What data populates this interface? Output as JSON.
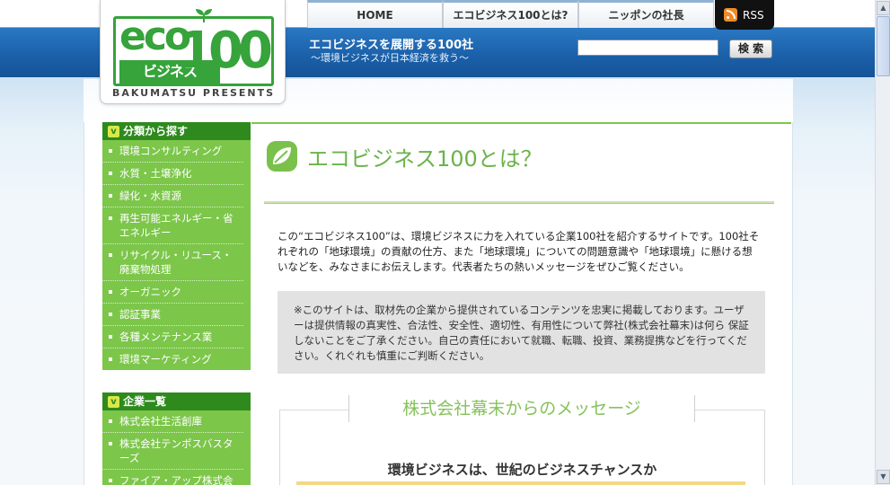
{
  "logo": {
    "eco": "eco",
    "biz": "ビジネス",
    "num": "100",
    "presents": "BAKUMATSU PRESENTS"
  },
  "nav": {
    "tabs": [
      "HOME",
      "エコビジネス100とは?",
      "ニッポンの社長"
    ],
    "rss": "RSS"
  },
  "header": {
    "tagline_main": "エコビジネスを展開する100社",
    "tagline_sub": "〜環境ビジネスが日本経済を救う〜"
  },
  "search": {
    "value": "",
    "placeholder": "",
    "button": "検 索"
  },
  "sidebar": {
    "category_heading": "分類から探す",
    "categories": [
      "環境コンサルティング",
      "水質・土壌浄化",
      "緑化・水資源",
      "再生可能エネルギー・省エネルギー",
      "リサイクル・リユース・廃棄物処理",
      "オーガニック",
      "認証事業",
      "各種メンテナンス業",
      "環境マーケティング"
    ],
    "company_heading": "企業一覧",
    "companies": [
      "株式会社生活創庫",
      "株式会社テンポスバスターズ",
      "ファイア・アップ株式会社"
    ]
  },
  "main": {
    "title": "エコビジネス100とは？",
    "intro": "この“エコビジネス100”は、環境ビジネスに力を入れている企業100社を紹介するサイトです。100社それぞれの「地球環境」の貢献の仕方、また「地球環境」についての問題意識や「地球環境」に懸ける想 いなどを、みなさまにお伝えします。代表者たちの熱いメッセージをぜひご覧ください。",
    "notice": "※このサイトは、取材先の企業から提供されているコンテンツを忠実に掲載しております。ユーザーは提供情報の真実性、合法性、安全性、適切性、有用性について弊社(株式会社幕末)は何ら 保証しないことをご了承ください。自己の責任において就職、転職、投資、業務提携などを行ってください。くれぐれも慎重にご判断ください。",
    "message_title": "株式会社幕末からのメッセージ",
    "message_sub": "環境ビジネスは、世紀のビジネスチャンスか"
  },
  "colors": {
    "green": "#7cc64a",
    "dark_green": "#2f8a1e",
    "blue": "#1a5fa8",
    "title_green": "#6bb34a"
  }
}
